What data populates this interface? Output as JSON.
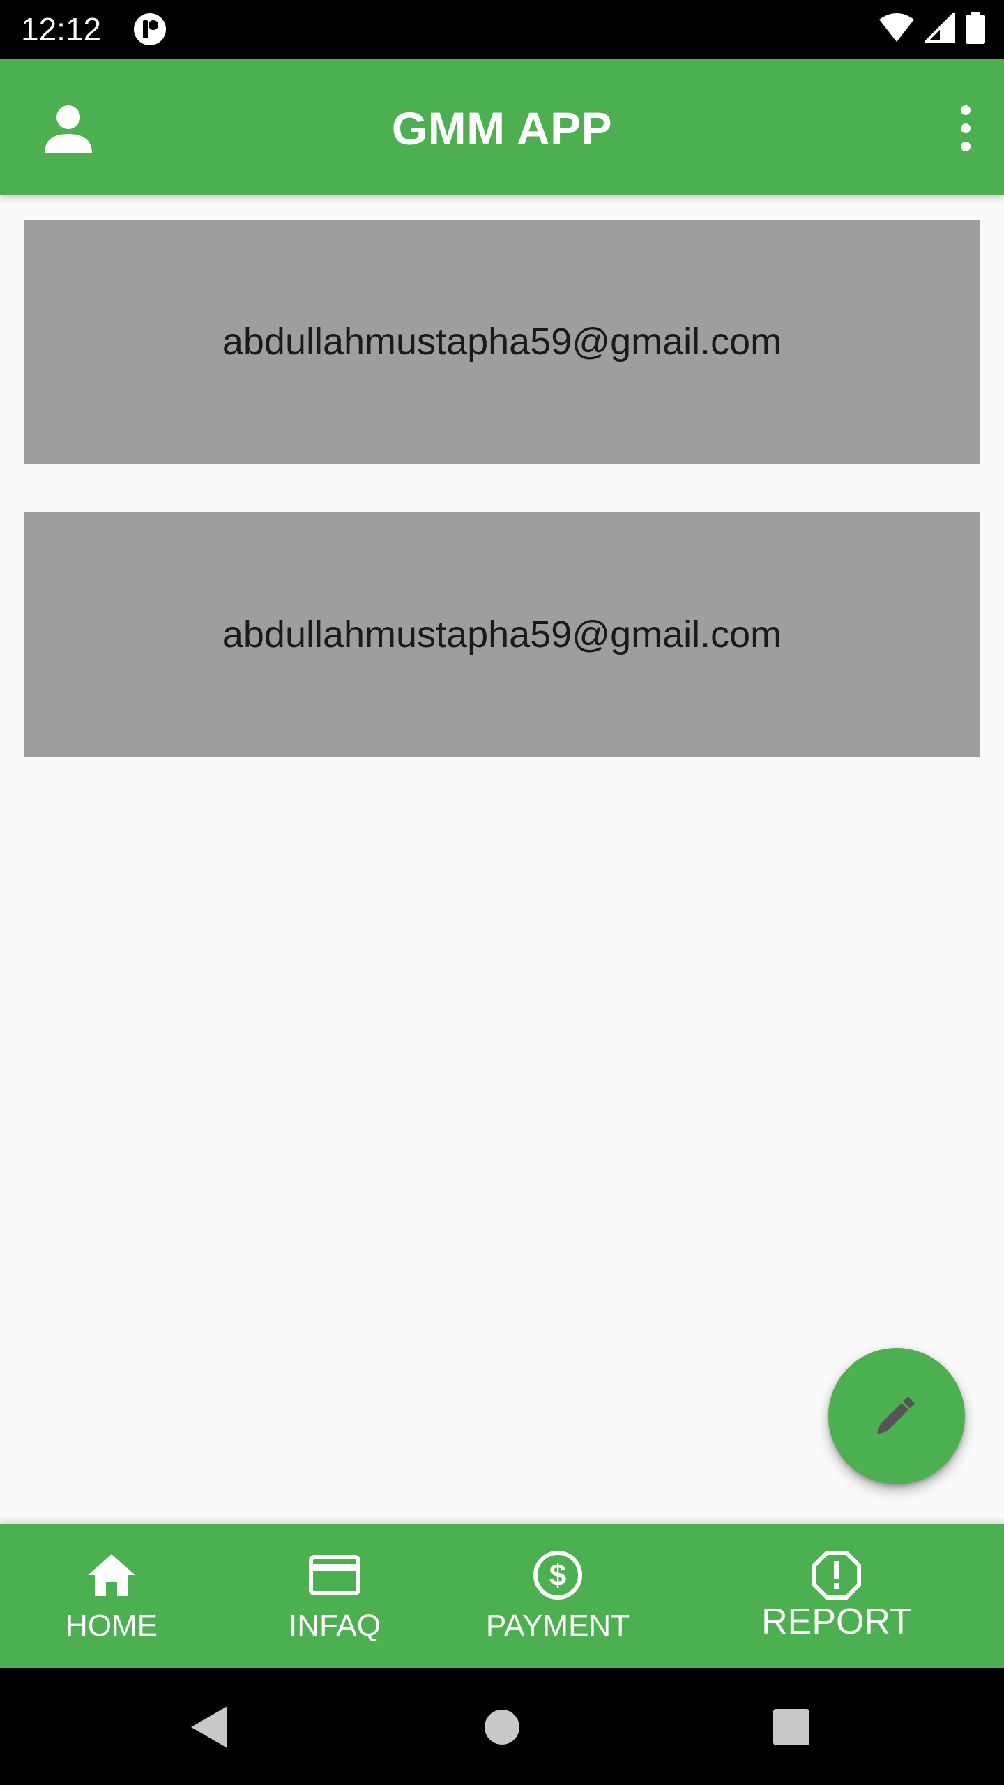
{
  "status_bar": {
    "time": "12:12",
    "icons": [
      "app-notification-icon",
      "wifi-icon",
      "signal-icon",
      "battery-icon"
    ]
  },
  "app_bar": {
    "title": "GMM APP",
    "left_icon": "person-icon",
    "right_icon": "more-vert-icon"
  },
  "cards": [
    {
      "email": "abdullahmustapha59@gmail.com"
    },
    {
      "email": "abdullahmustapha59@gmail.com"
    }
  ],
  "fab": {
    "icon": "edit-pencil-icon"
  },
  "bottom_nav": {
    "items": [
      {
        "label": "HOME",
        "icon": "home-icon"
      },
      {
        "label": "INFAQ",
        "icon": "credit-card-icon"
      },
      {
        "label": "PAYMENT",
        "icon": "dollar-circle-icon"
      },
      {
        "label": "REPORT",
        "icon": "report-alert-icon"
      }
    ]
  },
  "system_nav": {
    "buttons": [
      "back-icon",
      "home-circle-icon",
      "recents-icon"
    ]
  },
  "colors": {
    "primary": "#4caf50",
    "card_bg": "#9e9e9e",
    "background": "#fafafa",
    "system_bars": "#000000"
  }
}
